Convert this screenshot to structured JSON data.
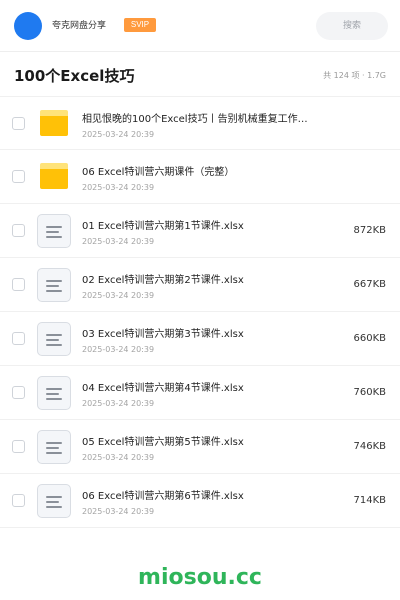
{
  "header": {
    "account_name": "夸克网盘分享",
    "badge": "SVIP",
    "search_placeholder": "搜索"
  },
  "folder": {
    "title": "100个Excel技巧",
    "summary": "共 124 项 · 1.7G"
  },
  "files": [
    {
      "icon": "folder-icon",
      "name": "相见恨晚的100个Excel技巧丨告别机械重复工作…",
      "date": "2025-03-24 20:39",
      "size": ""
    },
    {
      "icon": "folder-icon",
      "name": "06 Excel特训营六期课件（完整）",
      "date": "2025-03-24 20:39",
      "size": ""
    },
    {
      "icon": "document-icon",
      "name": "01 Excel特训营六期第1节课件.xlsx",
      "date": "2025-03-24 20:39",
      "size": "872KB"
    },
    {
      "icon": "document-icon",
      "name": "02 Excel特训营六期第2节课件.xlsx",
      "date": "2025-03-24 20:39",
      "size": "667KB"
    },
    {
      "icon": "document-icon",
      "name": "03 Excel特训营六期第3节课件.xlsx",
      "date": "2025-03-24 20:39",
      "size": "660KB"
    },
    {
      "icon": "document-icon",
      "name": "04 Excel特训营六期第4节课件.xlsx",
      "date": "2025-03-24 20:39",
      "size": "760KB"
    },
    {
      "icon": "document-icon",
      "name": "05 Excel特训营六期第5节课件.xlsx",
      "date": "2025-03-24 20:39",
      "size": "746KB"
    },
    {
      "icon": "document-icon",
      "name": "06 Excel特训营六期第6节课件.xlsx",
      "date": "2025-03-24 20:39",
      "size": "714KB"
    }
  ],
  "watermark": "miosou.cc",
  "colors": {
    "avatar": "#1f7af0",
    "svip_badge": "#ff9a3d",
    "folder": "#ffc107",
    "watermark": "#2fb55a"
  }
}
